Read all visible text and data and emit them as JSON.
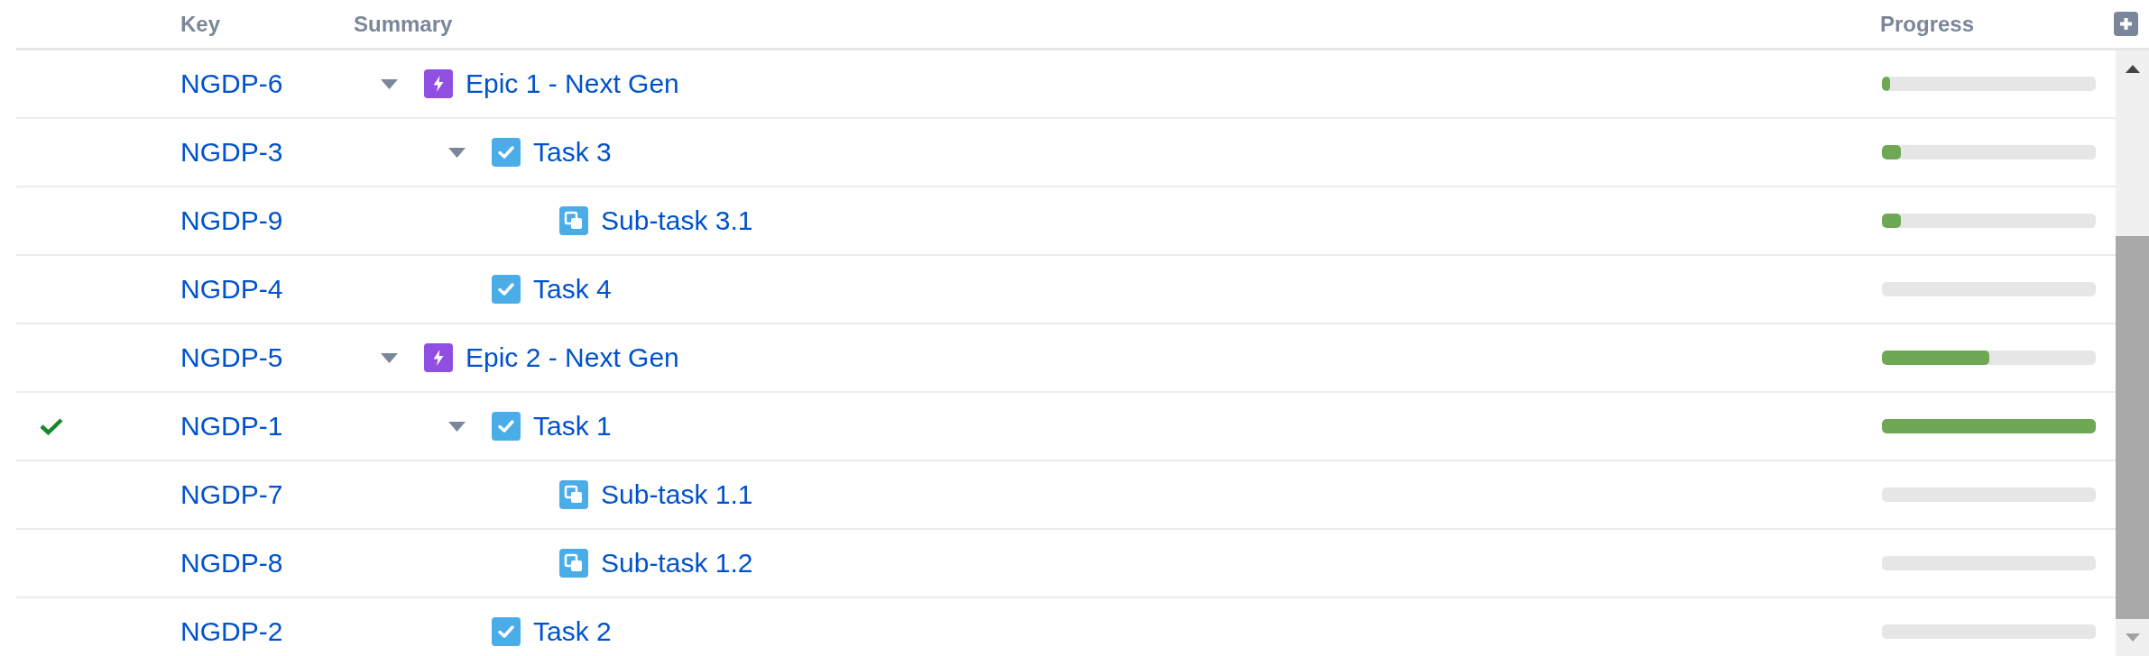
{
  "table": {
    "columns": [
      "Key",
      "Summary",
      "Progress"
    ],
    "rows": [
      {
        "key": "NGDP-6",
        "summary": "Epic 1 - Next Gen",
        "kind": "epic",
        "expanded": true,
        "resolved": false,
        "level": 0.03,
        "children": [
          {
            "key": "NGDP-3",
            "summary": "Task 3",
            "kind": "task",
            "expanded": true,
            "resolved": false,
            "level": 0.09,
            "children": [
              {
                "key": "NGDP-9",
                "summary": "Sub-task 3.1",
                "kind": "subtask",
                "resolved": false,
                "level": 0.09
              }
            ]
          },
          {
            "key": "NGDP-4",
            "summary": "Task 4",
            "kind": "task",
            "resolved": false
          }
        ]
      },
      {
        "key": "NGDP-5",
        "summary": "Epic 2 - Next Gen",
        "kind": "epic",
        "expanded": true,
        "resolved": false,
        "level": 0.5,
        "children": [
          {
            "key": "NGDP-1",
            "summary": "Task 1",
            "kind": "task",
            "expanded": true,
            "resolved": true,
            "level": 1,
            "children": [
              {
                "key": "NGDP-7",
                "summary": "Sub-task 1.1",
                "kind": "subtask",
                "resolved": false
              },
              {
                "key": "NGDP-8",
                "summary": "Sub-task 1.2",
                "kind": "subtask",
                "resolved": false
              }
            ]
          },
          {
            "key": "NGDP-2",
            "summary": "Task 2",
            "kind": "task",
            "resolved": false
          }
        ]
      }
    ]
  }
}
